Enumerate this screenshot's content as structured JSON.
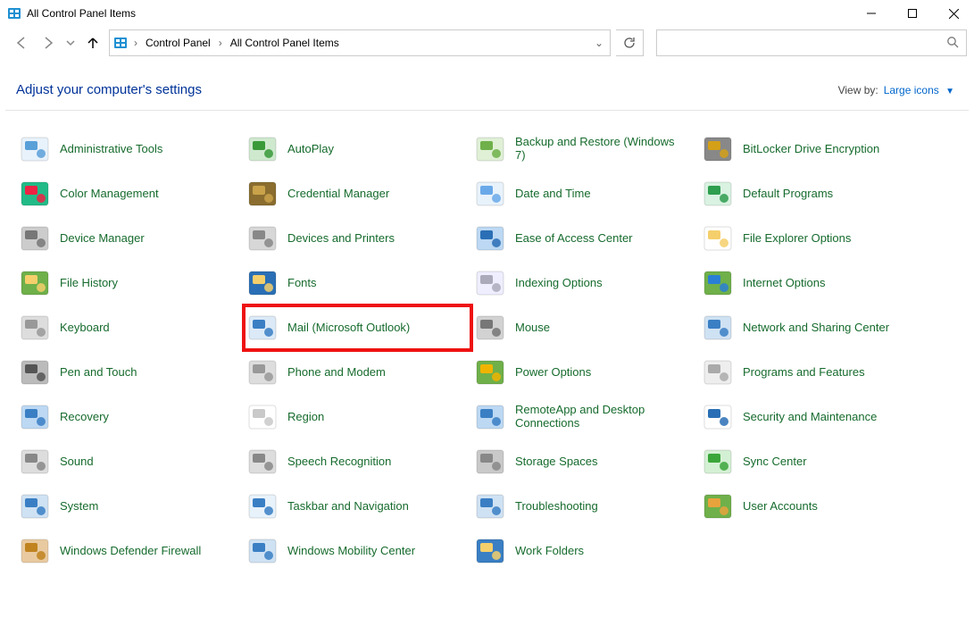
{
  "window": {
    "title": "All Control Panel Items"
  },
  "breadcrumb": {
    "root": "Control Panel",
    "current": "All Control Panel Items"
  },
  "heading": "Adjust your computer's settings",
  "viewby": {
    "label": "View by:",
    "value": "Large icons"
  },
  "items": [
    {
      "label": "Administrative Tools",
      "key": "administrative-tools",
      "c1": "#5aa0d8",
      "c2": "#e8f2fb"
    },
    {
      "label": "AutoPlay",
      "key": "autoplay",
      "c1": "#3a9a3a",
      "c2": "#cfe9cf"
    },
    {
      "label": "Backup and Restore (Windows 7)",
      "key": "backup-and-restore",
      "c1": "#6fb04a",
      "c2": "#dff0d6"
    },
    {
      "label": "BitLocker Drive Encryption",
      "key": "bitlocker",
      "c1": "#d4a017",
      "c2": "#888"
    },
    {
      "label": "Color Management",
      "key": "color-management",
      "c1": "#e24",
      "c2": "#2b8"
    },
    {
      "label": "Credential Manager",
      "key": "credential-manager",
      "c1": "#c9a24a",
      "c2": "#8a6d2f"
    },
    {
      "label": "Date and Time",
      "key": "date-and-time",
      "c1": "#6aa9e9",
      "c2": "#e8f2fb"
    },
    {
      "label": "Default Programs",
      "key": "default-programs",
      "c1": "#2e9e4f",
      "c2": "#d9f2e1"
    },
    {
      "label": "Device Manager",
      "key": "device-manager",
      "c1": "#777",
      "c2": "#ccc"
    },
    {
      "label": "Devices and Printers",
      "key": "devices-and-printers",
      "c1": "#888",
      "c2": "#d7d7d7"
    },
    {
      "label": "Ease of Access Center",
      "key": "ease-of-access",
      "c1": "#2a6fb5",
      "c2": "#bcd8f3"
    },
    {
      "label": "File Explorer Options",
      "key": "file-explorer-options",
      "c1": "#f5cf6b",
      "c2": "#fff"
    },
    {
      "label": "File History",
      "key": "file-history",
      "c1": "#f5cf6b",
      "c2": "#6fb04a"
    },
    {
      "label": "Fonts",
      "key": "fonts",
      "c1": "#f5cf6b",
      "c2": "#2a6fb5"
    },
    {
      "label": "Indexing Options",
      "key": "indexing-options",
      "c1": "#aab",
      "c2": "#eef"
    },
    {
      "label": "Internet Options",
      "key": "internet-options",
      "c1": "#2a7fd4",
      "c2": "#6fb04a"
    },
    {
      "label": "Keyboard",
      "key": "keyboard",
      "c1": "#999",
      "c2": "#ddd"
    },
    {
      "label": "Mail (Microsoft Outlook)",
      "key": "mail",
      "c1": "#3a7fc4",
      "c2": "#dceaf7",
      "highlight": true
    },
    {
      "label": "Mouse",
      "key": "mouse",
      "c1": "#777",
      "c2": "#d2d2d2"
    },
    {
      "label": "Network and Sharing Center",
      "key": "network-sharing",
      "c1": "#3a7fc4",
      "c2": "#cfe2f3"
    },
    {
      "label": "Pen and Touch",
      "key": "pen-and-touch",
      "c1": "#555",
      "c2": "#bbb"
    },
    {
      "label": "Phone and Modem",
      "key": "phone-and-modem",
      "c1": "#999",
      "c2": "#ddd"
    },
    {
      "label": "Power Options",
      "key": "power-options",
      "c1": "#f0b400",
      "c2": "#6fb04a"
    },
    {
      "label": "Programs and Features",
      "key": "programs-and-features",
      "c1": "#aaa",
      "c2": "#eee"
    },
    {
      "label": "Recovery",
      "key": "recovery",
      "c1": "#3a7fc4",
      "c2": "#bcd8f3"
    },
    {
      "label": "Region",
      "key": "region",
      "c1": "#c9c9c9",
      "c2": "#fff"
    },
    {
      "label": "RemoteApp and Desktop Connections",
      "key": "remoteapp",
      "c1": "#3a7fc4",
      "c2": "#bcd8f3"
    },
    {
      "label": "Security and Maintenance",
      "key": "security-maintenance",
      "c1": "#2a6fb5",
      "c2": "#fff"
    },
    {
      "label": "Sound",
      "key": "sound",
      "c1": "#888",
      "c2": "#ddd"
    },
    {
      "label": "Speech Recognition",
      "key": "speech-recognition",
      "c1": "#888",
      "c2": "#ddd"
    },
    {
      "label": "Storage Spaces",
      "key": "storage-spaces",
      "c1": "#888",
      "c2": "#c9c9c9"
    },
    {
      "label": "Sync Center",
      "key": "sync-center",
      "c1": "#3aa63a",
      "c2": "#d4f0d4"
    },
    {
      "label": "System",
      "key": "system",
      "c1": "#3a7fc4",
      "c2": "#cfe2f3"
    },
    {
      "label": "Taskbar and Navigation",
      "key": "taskbar",
      "c1": "#3a7fc4",
      "c2": "#e8f2fb"
    },
    {
      "label": "Troubleshooting",
      "key": "troubleshooting",
      "c1": "#3a7fc4",
      "c2": "#cfe2f3"
    },
    {
      "label": "User Accounts",
      "key": "user-accounts",
      "c1": "#e8a33d",
      "c2": "#6fb04a"
    },
    {
      "label": "Windows Defender Firewall",
      "key": "defender-firewall",
      "c1": "#c0831f",
      "c2": "#e9caa0"
    },
    {
      "label": "Windows Mobility Center",
      "key": "mobility-center",
      "c1": "#3a7fc4",
      "c2": "#cfe2f3"
    },
    {
      "label": "Work Folders",
      "key": "work-folders",
      "c1": "#f5cf6b",
      "c2": "#3a7fc4"
    }
  ]
}
